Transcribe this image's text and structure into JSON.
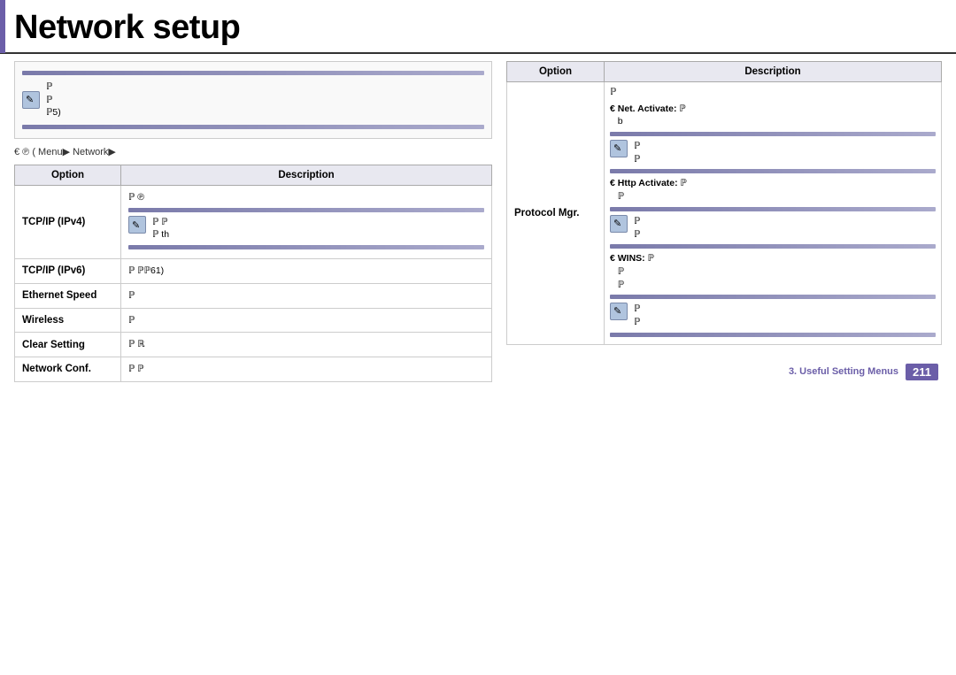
{
  "page": {
    "title": "Network setup",
    "accent_color": "#6b5ea8"
  },
  "footer": {
    "section_label": "3.  Useful Setting Menus",
    "page_number": "211"
  },
  "left": {
    "nav": {
      "symbols": "€  ℗  (    Menu▶  Network▶"
    },
    "table": {
      "col_option": "Option",
      "col_desc": "Description",
      "rows": [
        {
          "option": "TCP/IP (IPv4)",
          "desc_lines": [
            "ℙ",
            "℗",
            "ℙ",
            "ℙ",
            "ℙ",
            "ℙ th"
          ]
        },
        {
          "option": "TCP/IP (IPv6)",
          "desc_lines": [
            "ℙ",
            "ℙℙ61)"
          ]
        },
        {
          "option": "Ethernet Speed",
          "desc_lines": [
            "ℙ"
          ]
        },
        {
          "option": "Wireless",
          "desc_lines": [
            "ℙ"
          ]
        },
        {
          "option": "Clear Setting",
          "desc_lines": [
            "ℙ",
            "ℝ"
          ]
        },
        {
          "option": "Network Conf.",
          "desc_lines": [
            "ℙ",
            "ℙ"
          ]
        }
      ]
    }
  },
  "right": {
    "table": {
      "col_option": "Option",
      "col_desc": "Description",
      "option_label": "Protocol Mgr.",
      "sections": [
        {
          "type": "text",
          "content": "ℙ"
        },
        {
          "type": "note",
          "label": "€  Net. Activate:",
          "text": "ℙ b"
        },
        {
          "type": "icon-block",
          "lines": [
            "ℙ",
            "ℙ"
          ]
        },
        {
          "type": "note",
          "label": "€  Http Activate:",
          "text": "ℙ ℙ"
        },
        {
          "type": "icon-block",
          "lines": [
            "ℙ",
            "ℙ"
          ]
        },
        {
          "type": "note",
          "label": "€  WINS:",
          "text": "ℙ ℙ ℙ"
        },
        {
          "type": "icon-block",
          "lines": [
            "ℙ",
            "ℙ"
          ]
        }
      ]
    }
  }
}
